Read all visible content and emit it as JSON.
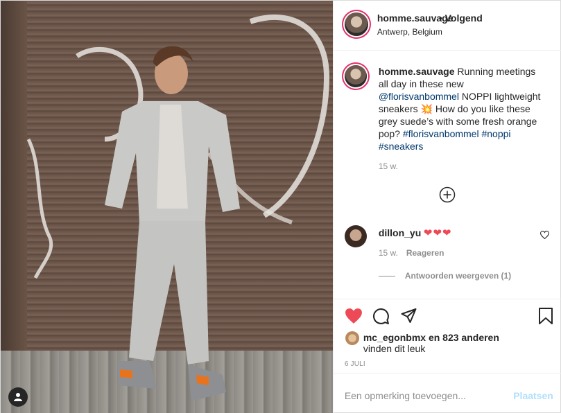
{
  "post": {
    "username": "homme.sauvage",
    "follow_label": "• Volgend",
    "location": "Antwerp, Belgium",
    "caption_user": "homme.sauvage",
    "caption_text_1": "Running meetings all day in these new",
    "caption_mention": "@florisvanbommel",
    "caption_text_2": "NOPPI lightweight sneakers 💥 How do you like these grey suede’s with some fresh orange pop?",
    "caption_tag_1": "#florisvanbommel",
    "caption_tag_2": "#noppi",
    "caption_tag_3": "#sneakers",
    "caption_age": "15 w."
  },
  "comment": {
    "username": "dillon_yu",
    "text": "❤❤❤",
    "age": "15 w.",
    "reply_label": "Reageren",
    "view_replies": "Antwoorden weergeven (1)"
  },
  "likes": {
    "user": "mc_egonbmx",
    "suffix": "en 823 anderen",
    "line2": "vinden dit leuk"
  },
  "date": "6 JULI",
  "add_comment": {
    "placeholder": "Een opmerking toevoegen...",
    "post_label": "Plaatsen"
  },
  "colors": {
    "like": "#ed4956",
    "link": "#00376b",
    "muted": "#8e8e8e"
  },
  "icons": [
    "heart-icon",
    "comment-icon",
    "share-icon",
    "bookmark-icon",
    "plus-circle-icon",
    "user-icon"
  ]
}
